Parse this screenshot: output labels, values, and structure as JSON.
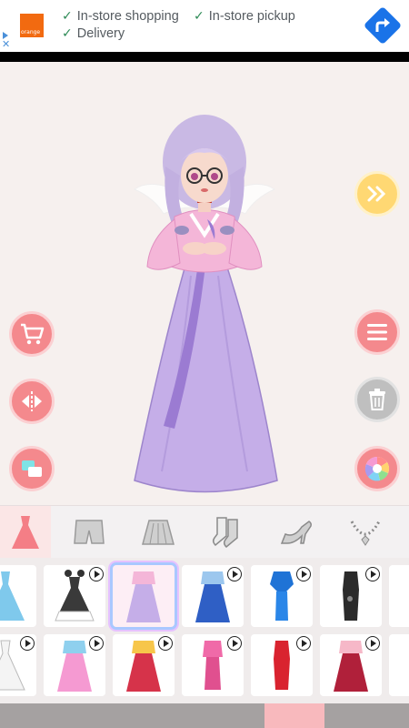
{
  "ad": {
    "brand": "orange",
    "items": [
      "In-store shopping",
      "In-store pickup",
      "Delivery"
    ],
    "check_glyph": "✓",
    "colors": {
      "check": "#2e8b57",
      "cta": "#1a73e8",
      "brand": "#f26a10"
    }
  },
  "stage": {
    "left_buttons": [
      "cart-icon",
      "flip-icon",
      "layers-icon"
    ],
    "right_buttons": [
      "fast-forward-icon",
      "menu-icon",
      "trash-icon",
      "palette-icon"
    ]
  },
  "categories": {
    "items": [
      "dress-icon",
      "shorts-icon",
      "skirt-icon",
      "socks-icon",
      "high-heel-icon",
      "necklace-icon"
    ],
    "active": "dress-icon"
  },
  "outfits": {
    "row1": [
      {
        "name": "blue-gown",
        "video": false
      },
      {
        "name": "black-white-gown",
        "video": true
      },
      {
        "name": "lavender-hanbok",
        "video": false,
        "selected": true
      },
      {
        "name": "blue-hanbok",
        "video": true
      },
      {
        "name": "blue-qipao",
        "video": true
      },
      {
        "name": "black-qipao",
        "video": true
      }
    ],
    "row2": [
      {
        "name": "white-gown",
        "video": true
      },
      {
        "name": "pink-hanbok",
        "video": true
      },
      {
        "name": "yellow-red-hanbok",
        "video": true
      },
      {
        "name": "pink-qipao",
        "video": true
      },
      {
        "name": "red-qipao",
        "video": true
      },
      {
        "name": "dark-red-hanbok",
        "video": true
      }
    ]
  },
  "colors": {
    "accent_pink": "#f4898d",
    "accent_yellow": "#ffd873",
    "neutral_grey": "#bfbfbf",
    "stage_bg": "#f6f0ee"
  }
}
